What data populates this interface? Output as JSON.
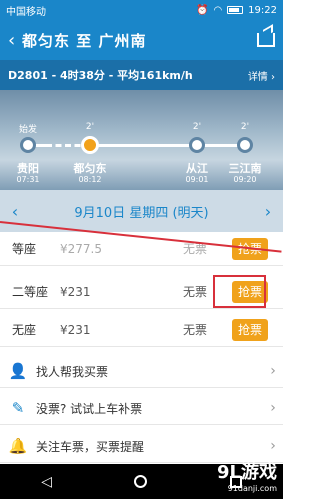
{
  "status_bar": {
    "carrier": "中国移动",
    "time": "19:22"
  },
  "header": {
    "title": "都匀东 至 广州南",
    "back_icon": "back-chevron-icon",
    "share_icon": "share-icon"
  },
  "train": {
    "info": "D2801 - 4时38分 - 平均161km/h",
    "detail": "详情 ›"
  },
  "route": {
    "stations": [
      {
        "name": "贵阳",
        "time": "07:31",
        "mark": "始发"
      },
      {
        "name": "都匀东",
        "time": "08:12",
        "mark": "2'"
      },
      {
        "name": "从江",
        "time": "09:01",
        "mark": "2'"
      },
      {
        "name": "三江南",
        "time": "09:20",
        "mark": "2'"
      }
    ]
  },
  "date_bar": {
    "prev": "‹",
    "date": "9月10日 星期四 (明天)",
    "next": "›"
  },
  "seats": [
    {
      "name": "等座",
      "price": "¥277.5",
      "stock": "无票",
      "buy": "抢票"
    },
    {
      "name": "二等座",
      "price": "¥231",
      "stock": "无票",
      "buy": "抢票"
    },
    {
      "name": "无座",
      "price": "¥231",
      "stock": "无票",
      "buy": "抢票"
    }
  ],
  "menu": [
    {
      "label": "找人帮我买票",
      "icon": "person-icon"
    },
    {
      "label": "没票? 试试上车补票",
      "icon": "ticket-icon"
    },
    {
      "label": "关注车票，买票提醒",
      "icon": "bell-icon"
    }
  ],
  "watermark": {
    "logo": "9L游戏",
    "site": "91danji.com"
  },
  "colors": {
    "primary": "#1a86c9",
    "accent": "#f0a21b",
    "highlight": "#d8303b"
  }
}
